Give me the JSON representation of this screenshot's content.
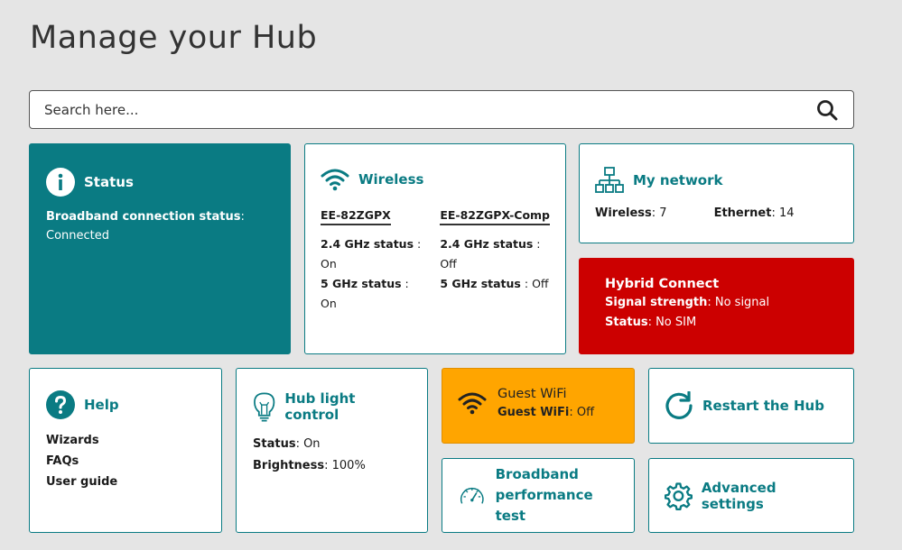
{
  "page_title": "Manage your Hub",
  "search": {
    "placeholder": "Search here..."
  },
  "colors": {
    "teal": "#0a7b83",
    "red": "#cc0000",
    "orange": "#ffa500"
  },
  "status": {
    "title": "Status",
    "label": "Broadband connection status",
    "value": "Connected"
  },
  "wireless": {
    "title": "Wireless",
    "networks": [
      {
        "ssid": "EE-82ZGPX",
        "band24_label": "2.4 GHz status",
        "band24_value": "On",
        "band5_label": "5 GHz status",
        "band5_value": "On"
      },
      {
        "ssid": "EE-82ZGPX-Comp",
        "band24_label": "2.4 GHz status",
        "band24_value": "Off",
        "band5_label": "5 GHz status",
        "band5_value": "Off"
      }
    ]
  },
  "my_network": {
    "title": "My network",
    "wireless_label": "Wireless",
    "wireless_value": "7",
    "ethernet_label": "Ethernet",
    "ethernet_value": "14"
  },
  "hybrid": {
    "title": "Hybrid Connect",
    "signal_label": "Signal strength",
    "signal_value": "No signal",
    "status_label": "Status",
    "status_value": "No SIM"
  },
  "help": {
    "title": "Help",
    "links": [
      "Wizards",
      "FAQs",
      "User guide"
    ]
  },
  "hub_light": {
    "title": "Hub light control",
    "status_label": "Status",
    "status_value": "On",
    "brightness_label": "Brightness",
    "brightness_value": "100%"
  },
  "guest_wifi": {
    "title": "Guest WiFi",
    "label": "Guest WiFi",
    "value": "Off"
  },
  "restart": {
    "title": "Restart the Hub"
  },
  "broadband_test": {
    "title_line1": "Broadband",
    "title_line2": "performance test"
  },
  "advanced": {
    "title": "Advanced settings"
  }
}
